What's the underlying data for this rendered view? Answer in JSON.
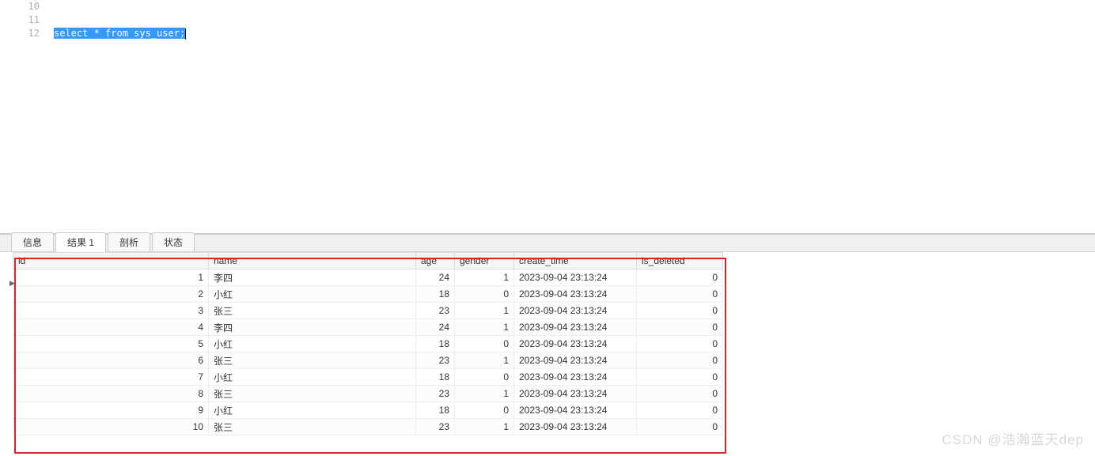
{
  "editor": {
    "lines": [
      "10",
      "11",
      "12"
    ],
    "code": "select * from sys_user;"
  },
  "tabs": {
    "items": [
      {
        "label": "信息",
        "active": false
      },
      {
        "label": "结果 1",
        "active": true
      },
      {
        "label": "剖析",
        "active": false
      },
      {
        "label": "状态",
        "active": false
      }
    ]
  },
  "table": {
    "columns": [
      "id",
      "name",
      "age",
      "gender",
      "create_time",
      "is_deleted"
    ],
    "rows": [
      {
        "id": "1",
        "name": "李四",
        "age": "24",
        "gender": "1",
        "create_time": "2023-09-04 23:13:24",
        "is_deleted": "0"
      },
      {
        "id": "2",
        "name": "小红",
        "age": "18",
        "gender": "0",
        "create_time": "2023-09-04 23:13:24",
        "is_deleted": "0"
      },
      {
        "id": "3",
        "name": "张三",
        "age": "23",
        "gender": "1",
        "create_time": "2023-09-04 23:13:24",
        "is_deleted": "0"
      },
      {
        "id": "4",
        "name": "李四",
        "age": "24",
        "gender": "1",
        "create_time": "2023-09-04 23:13:24",
        "is_deleted": "0"
      },
      {
        "id": "5",
        "name": "小红",
        "age": "18",
        "gender": "0",
        "create_time": "2023-09-04 23:13:24",
        "is_deleted": "0"
      },
      {
        "id": "6",
        "name": "张三",
        "age": "23",
        "gender": "1",
        "create_time": "2023-09-04 23:13:24",
        "is_deleted": "0"
      },
      {
        "id": "7",
        "name": "小红",
        "age": "18",
        "gender": "0",
        "create_time": "2023-09-04 23:13:24",
        "is_deleted": "0"
      },
      {
        "id": "8",
        "name": "张三",
        "age": "23",
        "gender": "1",
        "create_time": "2023-09-04 23:13:24",
        "is_deleted": "0"
      },
      {
        "id": "9",
        "name": "小红",
        "age": "18",
        "gender": "0",
        "create_time": "2023-09-04 23:13:24",
        "is_deleted": "0"
      },
      {
        "id": "10",
        "name": "张三",
        "age": "23",
        "gender": "1",
        "create_time": "2023-09-04 23:13:24",
        "is_deleted": "0"
      }
    ]
  },
  "watermark": "CSDN @浩瀚蓝天dep",
  "row_marker": "▶"
}
